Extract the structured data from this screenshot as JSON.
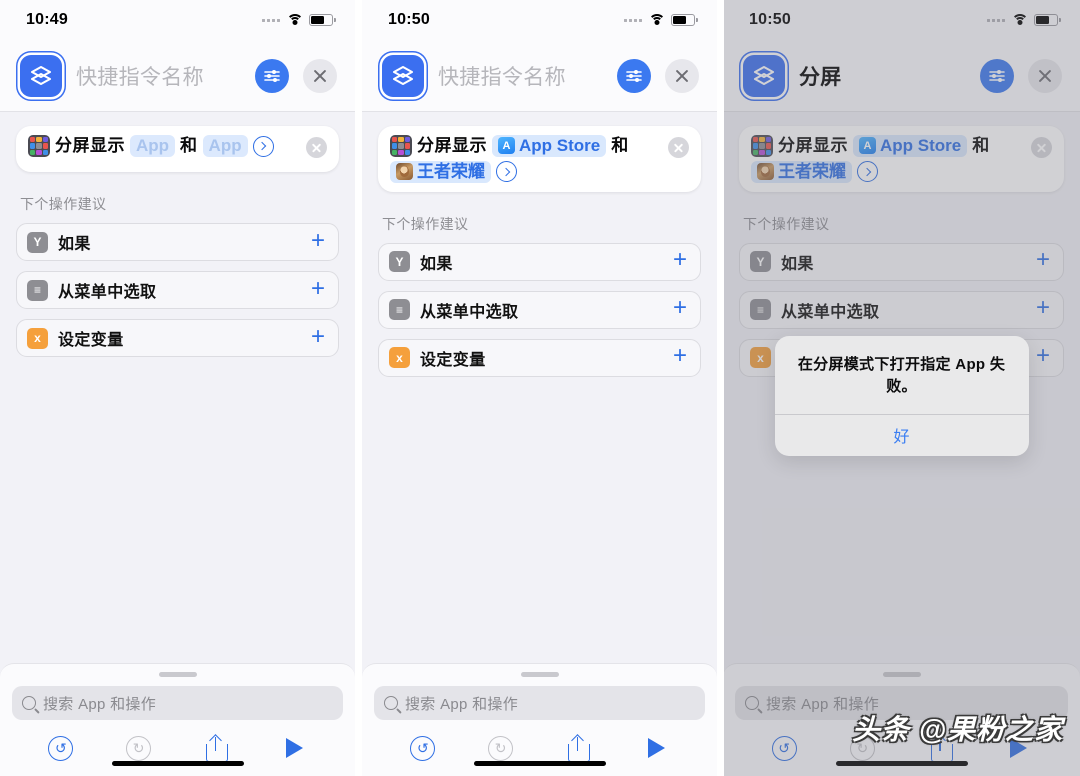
{
  "panels": [
    {
      "status": {
        "time": "10:49",
        "wifi_icon": "wifi-icon",
        "battery_icon": "battery-icon",
        "signal_icon": "signal-dots-icon"
      },
      "header": {
        "app_icon": "shortcuts-icon",
        "title": "快捷指令名称",
        "title_is_placeholder": true,
        "settings_icon": "sliders-icon",
        "close_icon": "close-icon"
      },
      "action": {
        "icon": "app-grid-icon",
        "label": "分屏显示",
        "chip1": "App",
        "chip1_resolved": false,
        "conjunction": "和",
        "chip2": "App",
        "chip2_resolved": false,
        "expand_icon": "chevron-right-circle-icon",
        "remove_icon": "remove-circle-icon"
      },
      "suggestions_title": "下个操作建议",
      "suggestions": [
        {
          "label": "如果",
          "icon": "if-icon",
          "glyph": "Y",
          "color": "gray",
          "add_icon": "plus-icon"
        },
        {
          "label": "从菜单中选取",
          "icon": "menu-list-icon",
          "glyph": "≡",
          "color": "gray",
          "add_icon": "plus-icon"
        },
        {
          "label": "设定变量",
          "icon": "variable-icon",
          "glyph": "x",
          "color": "orange",
          "add_icon": "plus-icon"
        }
      ],
      "bottom": {
        "search_placeholder": "搜索 App 和操作",
        "search_icon": "search-icon",
        "undo_icon": "undo-icon",
        "undo_glyph": "↺",
        "redo_icon": "redo-icon",
        "redo_glyph": "↻",
        "share_icon": "share-icon",
        "play_icon": "play-icon"
      },
      "alert": null
    },
    {
      "status": {
        "time": "10:50",
        "wifi_icon": "wifi-icon",
        "battery_icon": "battery-icon",
        "signal_icon": "signal-dots-icon"
      },
      "header": {
        "app_icon": "shortcuts-icon",
        "title": "快捷指令名称",
        "title_is_placeholder": true,
        "settings_icon": "sliders-icon",
        "close_icon": "close-icon"
      },
      "action": {
        "icon": "app-grid-icon",
        "label": "分屏显示",
        "chip1": "App Store",
        "chip1_resolved": true,
        "chip1_app_icon": "app-store-icon",
        "conjunction": "和",
        "chip2": "王者荣耀",
        "chip2_resolved": true,
        "chip2_app_icon": "honor-of-kings-icon",
        "expand_icon": "chevron-right-circle-icon",
        "remove_icon": "remove-circle-icon"
      },
      "suggestions_title": "下个操作建议",
      "suggestions": [
        {
          "label": "如果",
          "icon": "if-icon",
          "glyph": "Y",
          "color": "gray",
          "add_icon": "plus-icon"
        },
        {
          "label": "从菜单中选取",
          "icon": "menu-list-icon",
          "glyph": "≡",
          "color": "gray",
          "add_icon": "plus-icon"
        },
        {
          "label": "设定变量",
          "icon": "variable-icon",
          "glyph": "x",
          "color": "orange",
          "add_icon": "plus-icon"
        }
      ],
      "bottom": {
        "search_placeholder": "搜索 App 和操作",
        "search_icon": "search-icon",
        "undo_icon": "undo-icon",
        "undo_glyph": "↺",
        "redo_icon": "redo-icon",
        "redo_glyph": "↻",
        "share_icon": "share-icon",
        "play_icon": "play-icon"
      },
      "alert": null
    },
    {
      "status": {
        "time": "10:50",
        "wifi_icon": "wifi-icon",
        "battery_icon": "battery-icon",
        "signal_icon": "signal-dots-icon"
      },
      "header": {
        "app_icon": "shortcuts-icon",
        "title": "分屏",
        "title_is_placeholder": false,
        "settings_icon": "sliders-icon",
        "close_icon": "close-icon"
      },
      "action": {
        "icon": "app-grid-icon",
        "label": "分屏显示",
        "chip1": "App Store",
        "chip1_resolved": true,
        "chip1_app_icon": "app-store-icon",
        "conjunction": "和",
        "chip2": "王者荣耀",
        "chip2_resolved": true,
        "chip2_app_icon": "honor-of-kings-icon",
        "expand_icon": "chevron-right-circle-icon",
        "remove_icon": "remove-circle-icon"
      },
      "suggestions_title": "下个操作建议",
      "suggestions": [
        {
          "label": "如果",
          "icon": "if-icon",
          "glyph": "Y",
          "color": "gray",
          "add_icon": "plus-icon"
        },
        {
          "label": "从菜单中选取",
          "icon": "menu-list-icon",
          "glyph": "≡",
          "color": "gray",
          "add_icon": "plus-icon"
        },
        {
          "label": "设定变量",
          "icon": "variable-icon",
          "glyph": "x",
          "color": "orange",
          "add_icon": "plus-icon"
        }
      ],
      "bottom": {
        "search_placeholder": "搜索 App 和操作",
        "search_icon": "search-icon",
        "undo_icon": "undo-icon",
        "undo_glyph": "↺",
        "redo_icon": "redo-icon",
        "redo_glyph": "↻",
        "share_icon": "share-icon",
        "play_icon": "play-icon"
      },
      "alert": {
        "message": "在分屏模式下打开指定 App 失败。",
        "ok_label": "好"
      }
    }
  ],
  "watermark": "头条 @果粉之家",
  "colors": {
    "accent_blue": "#2f6fe4",
    "icon_blue": "#3b79f0",
    "chip_bg": "#dce9fd",
    "chip_text_placeholder": "#a9c4ee",
    "chip_text_resolved": "#2f6fe4",
    "orange": "#f5a03c",
    "gray": "#8e8e93",
    "panel_bg": "#f2f2f7",
    "bar_bg": "#fbfbfd"
  }
}
